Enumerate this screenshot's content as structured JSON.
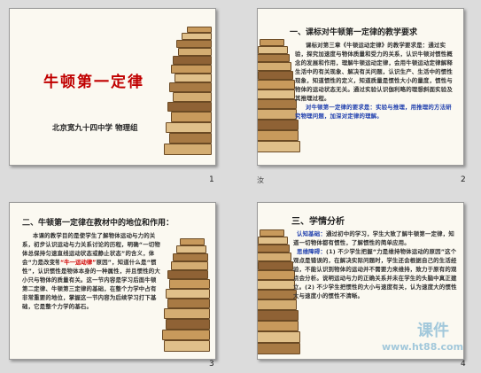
{
  "slides": [
    {
      "number": "1",
      "title": "牛顿第一定律",
      "subtitle": "北京宽九十四中学  物理组"
    },
    {
      "number": "2",
      "heading": "一、课标对牛顿第一定律的教学要求",
      "paragraph1": "课标对第三章《牛顿运动定律》的教学要求是：通过实验，探究加速度与物体质量和受力的关系，认识牛顿对惯性概念的发展和作用，理解牛顿运动定律，会用牛顿运动定律解释生活中的有关现象、解决有关问题，认识生产、生活中的惯性现象，知道惯性的定义，知道质量是惯性大小的量度，惯性与物体的运动状态无关。通过实验认识伽利略的理想斜面实验及其推理过程。",
      "paragraph2": "对牛顿第一定律的要求是：实验与推理，用推理的方法研究物理问题，加深对定律的理解。",
      "badge": "汝"
    },
    {
      "number": "3",
      "heading": "二、牛顿第一定律在教材中的地位和作用：",
      "paragraph": "本课的教学目的是使学生了解物体运动与力的关系，初步认识运动与力关系讨论的历程，明确“一切物体总保持匀速直线运动状态或静止状态”的含义，体会“力是改变物体运动状态的原因”，知道什么是“惯性”，认识惯性是物体本身的一种属性，并且惯性的大小只与物体的质量有关。这一节内容是学习后面牛顿第二定律、牛顿第三定律的基础，在整个力学中占有非常重要的地位，掌握这一节内容为后续学习打下基础，它是整个力学的基石。",
      "highlight": "“牛一运动律”"
    },
    {
      "number": "4",
      "heading": "三、学情分析",
      "label1": "认知基础：",
      "text1": "通过初中的学习，学生大致了解牛顿第一定律，知道一切物体都有惯性，了解惯性的简单应用。",
      "label2": "思维障碍：",
      "text2": "(1) 不少学生把握“力是维持物体运动的原因”这个观点是错误的，在解决实际问题时，学生还会根据自己的生活经验，不能认识到物体的运动并不需要力来维持，致力于原有的观点会分析。说明运动与力的正确关系并未在学生的头脑中真正建立。(2) 不少学生把惯性的大小与速度有关，认为速度大的惯性大与速度小的惯性不清晰。",
      "watermark": "课件",
      "watermark_url": "www.ht88.com"
    }
  ]
}
